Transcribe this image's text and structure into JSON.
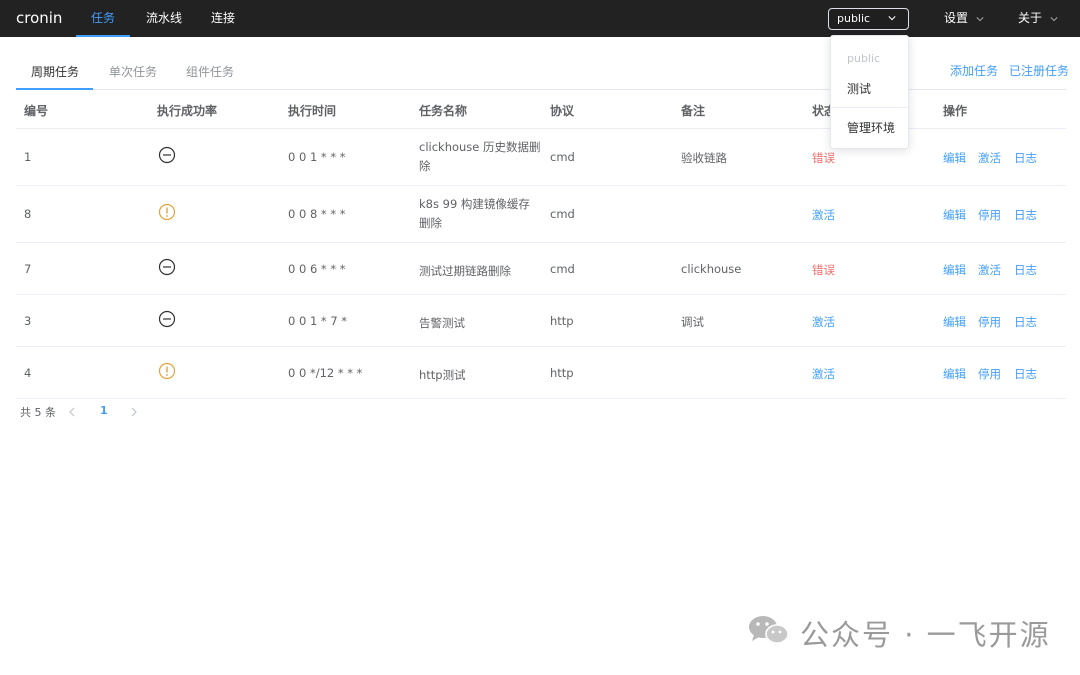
{
  "app": {
    "logo": "cronin"
  },
  "nav": {
    "items": [
      {
        "label": "任务",
        "active": true
      },
      {
        "label": "流水线"
      },
      {
        "label": "连接"
      }
    ]
  },
  "env": {
    "selected": "public",
    "options": [
      {
        "label": "public",
        "disabled": true
      },
      {
        "label": "测试"
      },
      {
        "label": "管理环境"
      }
    ]
  },
  "top_menus": {
    "settings": "设置",
    "about": "关于"
  },
  "tabs": [
    {
      "label": "周期任务",
      "active": true
    },
    {
      "label": "单次任务"
    },
    {
      "label": "组件任务"
    }
  ],
  "actions": {
    "add": "添加任务",
    "registered": "已注册任务"
  },
  "table": {
    "headers": [
      "编号",
      "执行成功率",
      "执行时间",
      "任务名称",
      "协议",
      "备注",
      "状态",
      "操作"
    ],
    "rows": [
      {
        "id": "1",
        "rate_icon": "minus-circle-icon",
        "time": "0 0 1 * * *",
        "name": "clickhouse 历史数据删除",
        "name_line1": "clickhouse 历史数据删",
        "name_line2": "除",
        "protocol": "cmd",
        "remark": "验收链路",
        "status": "错误",
        "status_type": "error",
        "ops": [
          "编辑",
          "激活",
          "日志"
        ]
      },
      {
        "id": "8",
        "rate_icon": "warning-circle-icon",
        "time": "0 0 8 * * *",
        "name": "k8s 99 构建镜像缓存删除",
        "name_line1": "k8s 99 构建镜像缓存",
        "name_line2": "删除",
        "protocol": "cmd",
        "remark": "",
        "status": "激活",
        "status_type": "active",
        "ops": [
          "编辑",
          "停用",
          "日志"
        ]
      },
      {
        "id": "7",
        "rate_icon": "minus-circle-icon",
        "time": "0 0 6 * * *",
        "name": "测试过期链路删除",
        "name_line1": "测试过期链路删除",
        "name_line2": "",
        "protocol": "cmd",
        "remark": "clickhouse",
        "status": "错误",
        "status_type": "error",
        "ops": [
          "编辑",
          "激活",
          "日志"
        ]
      },
      {
        "id": "3",
        "rate_icon": "minus-circle-icon",
        "time": "0 0 1 * 7 *",
        "name": "告警测试",
        "name_line1": "告警测试",
        "name_line2": "",
        "protocol": "http",
        "remark": "调试",
        "status": "激活",
        "status_type": "active",
        "ops": [
          "编辑",
          "停用",
          "日志"
        ]
      },
      {
        "id": "4",
        "rate_icon": "warning-circle-icon",
        "time": "0 0 */12 * * *",
        "name": "http测试",
        "name_line1": "http测试",
        "name_line2": "",
        "protocol": "http",
        "remark": "",
        "status": "激活",
        "status_type": "active",
        "ops": [
          "编辑",
          "停用",
          "日志"
        ]
      }
    ]
  },
  "pagination": {
    "total_text": "共 5 条",
    "current_page": "1"
  },
  "colors": {
    "accent": "#409eff",
    "error": "#f56c6c",
    "warning": "#e6a23c",
    "topbar": "#222222"
  },
  "watermark": {
    "text": "公众号 · 一飞开源"
  }
}
